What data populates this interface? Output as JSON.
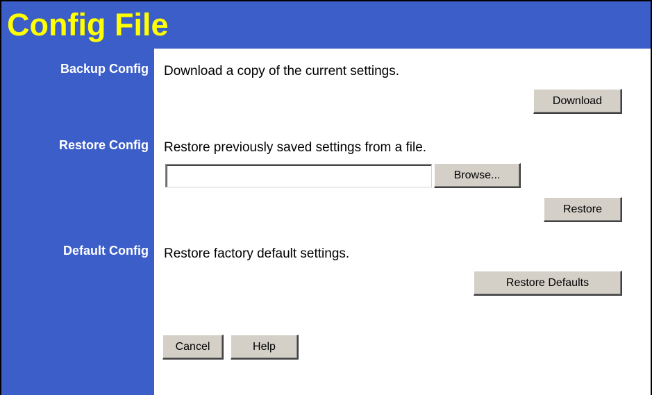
{
  "header": {
    "title": "Config File"
  },
  "sections": {
    "backup": {
      "label": "Backup Config",
      "description": "Download a copy of the current settings.",
      "button_label": "Download"
    },
    "restore": {
      "label": "Restore Config",
      "description": "Restore previously saved settings from a file.",
      "file_input_value": "",
      "browse_label": "Browse...",
      "button_label": "Restore"
    },
    "default": {
      "label": "Default Config",
      "description": "Restore factory default settings.",
      "button_label": "Restore Defaults"
    }
  },
  "footer": {
    "cancel_label": "Cancel",
    "help_label": "Help"
  },
  "colors": {
    "header_bg": "#3c5ec8",
    "title_text": "#ffff00",
    "label_text": "#ffffff",
    "button_face": "#d4d0c8"
  }
}
